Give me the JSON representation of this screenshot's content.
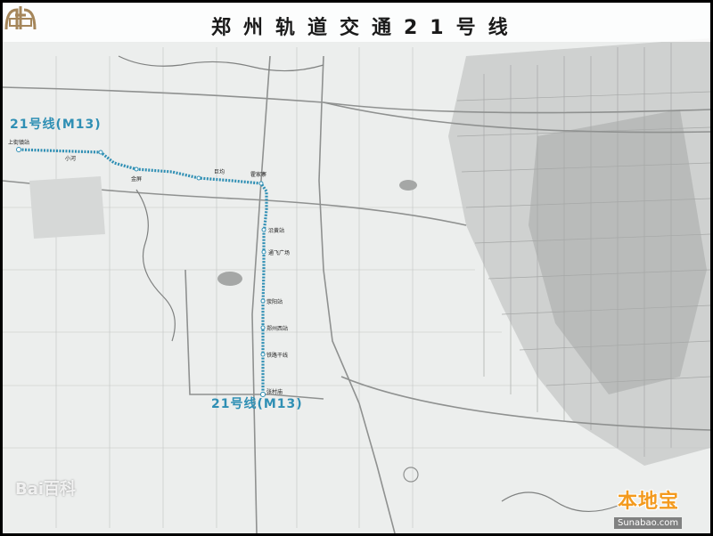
{
  "header": {
    "title": "郑州轨道交通21号线",
    "logo_icon": "metro-logo-icon"
  },
  "line": {
    "label_top": "21号线(M13)",
    "label_bottom": "21号线(M13)",
    "color": "#2f8fb4"
  },
  "stations": [
    {
      "name": "上街镇站"
    },
    {
      "name": "小河"
    },
    {
      "name": "金屏"
    },
    {
      "name": "巨均"
    },
    {
      "name": "霍家寨"
    },
    {
      "name": "沿黄站"
    },
    {
      "name": "通飞广场"
    },
    {
      "name": "荥阳站"
    },
    {
      "name": "郑州西站"
    },
    {
      "name": "铁路干线"
    },
    {
      "name": "张村庙"
    }
  ],
  "watermark": {
    "left_text": "Bai百科",
    "brand_name": "本地宝",
    "brand_url": "Sunabao.com"
  },
  "colors": {
    "map_bg": "#eceeed",
    "road": "#9a9c9b",
    "urban": "#c9cbca",
    "brand": "#f39a1e"
  }
}
